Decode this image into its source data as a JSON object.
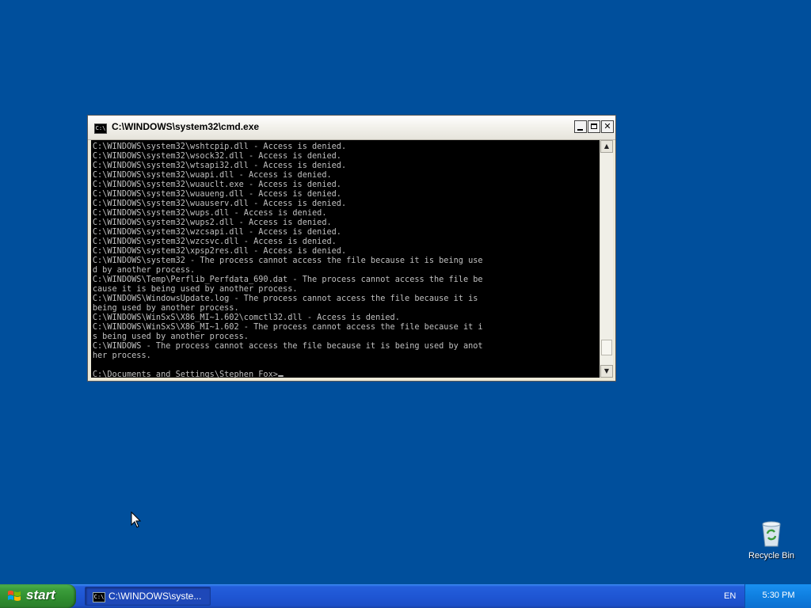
{
  "window": {
    "title": "C:\\WINDOWS\\system32\\cmd.exe",
    "icon_label": "C:\\",
    "console_lines": [
      "C:\\WINDOWS\\system32\\wshtcpip.dll - Access is denied.",
      "C:\\WINDOWS\\system32\\wsock32.dll - Access is denied.",
      "C:\\WINDOWS\\system32\\wtsapi32.dll - Access is denied.",
      "C:\\WINDOWS\\system32\\wuapi.dll - Access is denied.",
      "C:\\WINDOWS\\system32\\wuauclt.exe - Access is denied.",
      "C:\\WINDOWS\\system32\\wuaueng.dll - Access is denied.",
      "C:\\WINDOWS\\system32\\wuauserv.dll - Access is denied.",
      "C:\\WINDOWS\\system32\\wups.dll - Access is denied.",
      "C:\\WINDOWS\\system32\\wups2.dll - Access is denied.",
      "C:\\WINDOWS\\system32\\wzcsapi.dll - Access is denied.",
      "C:\\WINDOWS\\system32\\wzcsvc.dll - Access is denied.",
      "C:\\WINDOWS\\system32\\xpsp2res.dll - Access is denied.",
      "C:\\WINDOWS\\system32 - The process cannot access the file because it is being use",
      "d by another process.",
      "C:\\WINDOWS\\Temp\\Perflib_Perfdata_690.dat - The process cannot access the file be",
      "cause it is being used by another process.",
      "C:\\WINDOWS\\WindowsUpdate.log - The process cannot access the file because it is",
      "being used by another process.",
      "C:\\WINDOWS\\WinSxS\\X86_MI~1.602\\comctl32.dll - Access is denied.",
      "C:\\WINDOWS\\WinSxS\\X86_MI~1.602 - The process cannot access the file because it i",
      "s being used by another process.",
      "C:\\WINDOWS - The process cannot access the file because it is being used by anot",
      "her process.",
      "",
      "C:\\Documents and Settings\\Stephen Fox>"
    ],
    "scroll_position": 0.95
  },
  "desktop": {
    "recycle_bin_label": "Recycle Bin"
  },
  "taskbar": {
    "start_label": "start",
    "task_label": "C:\\WINDOWS\\syste...",
    "language": "EN",
    "clock": "5:30 PM"
  },
  "colors": {
    "desktop": "#004f9c",
    "console_bg": "#000000",
    "console_fg": "#c0c0c0",
    "taskbar": "#245edb",
    "start_button": "#3c9e3c"
  },
  "icons": {
    "window_icon": "cmd-icon",
    "recycle_bin": "recycle-bin-icon",
    "start_flag": "windows-flag-icon",
    "mouse": "mouse-pointer-icon"
  }
}
